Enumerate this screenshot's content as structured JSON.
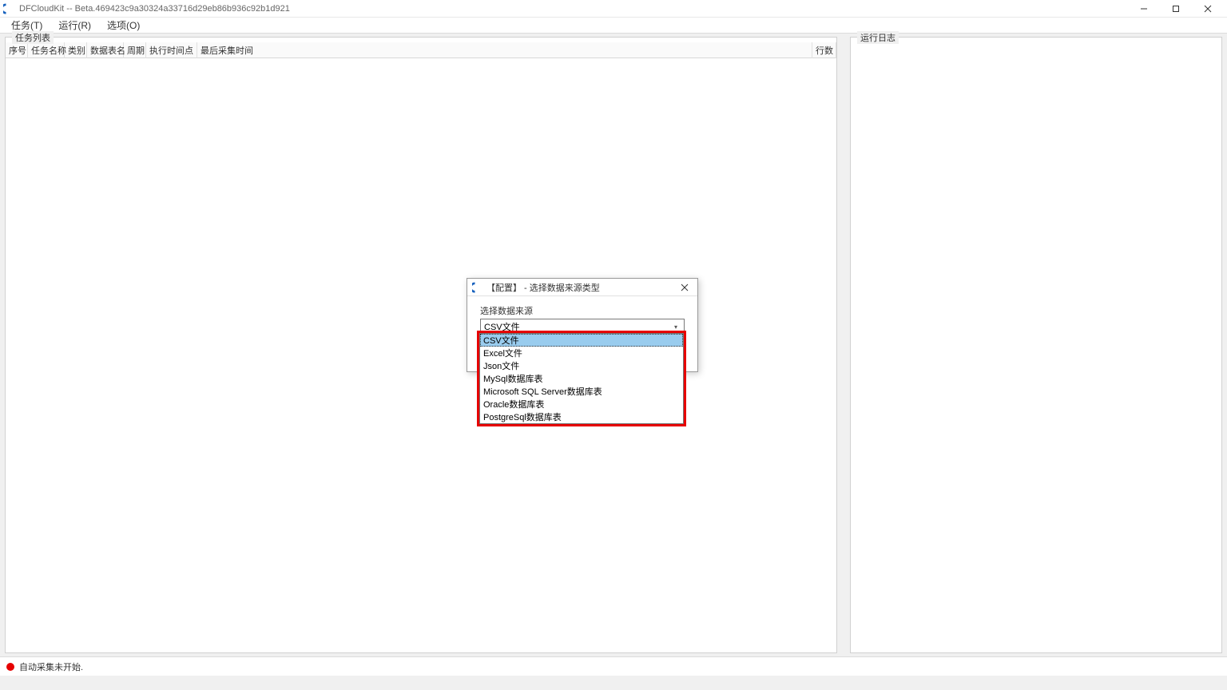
{
  "window": {
    "title": "DFCloudKit -- Beta.469423c9a30324a33716d29eb86b936c92b1d921"
  },
  "menu": {
    "tasks": "任务(T)",
    "run": "运行(R)",
    "options": "选项(O)"
  },
  "panels": {
    "task_list": "任务列表",
    "run_log": "运行日志"
  },
  "table": {
    "columns": {
      "seq": "序号",
      "name": "任务名称",
      "category": "类别",
      "table_name": "数据表名",
      "cycle": "周期",
      "exec_time": "执行时间点",
      "last_collect": "最后采集时间",
      "rows": "行数"
    }
  },
  "dialog": {
    "title": "【配置】 - 选择数据来源类型",
    "label": "选择数据来源",
    "selected": "CSV文件",
    "options": [
      "CSV文件",
      "Excel文件",
      "Json文件",
      "MySql数据库表",
      "Microsoft SQL Server数据库表",
      "Oracle数据库表",
      "PostgreSql数据库表"
    ]
  },
  "status": {
    "text": "自动采集未开始."
  }
}
